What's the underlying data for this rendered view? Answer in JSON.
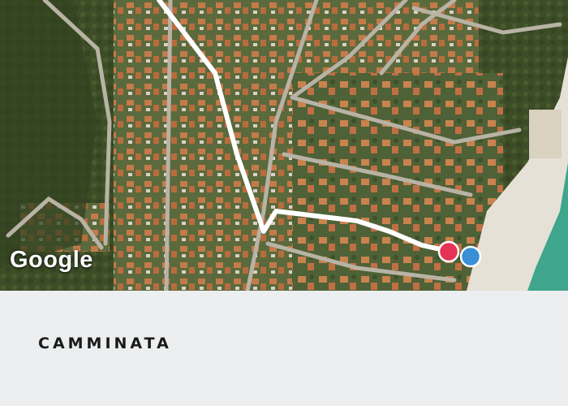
{
  "map": {
    "attribution": "Google",
    "route_color": "#ffffff",
    "start_marker_color": "#e53358",
    "end_marker_color": "#3a8fd6"
  },
  "activity": {
    "type_label": "CAMMINATA"
  }
}
